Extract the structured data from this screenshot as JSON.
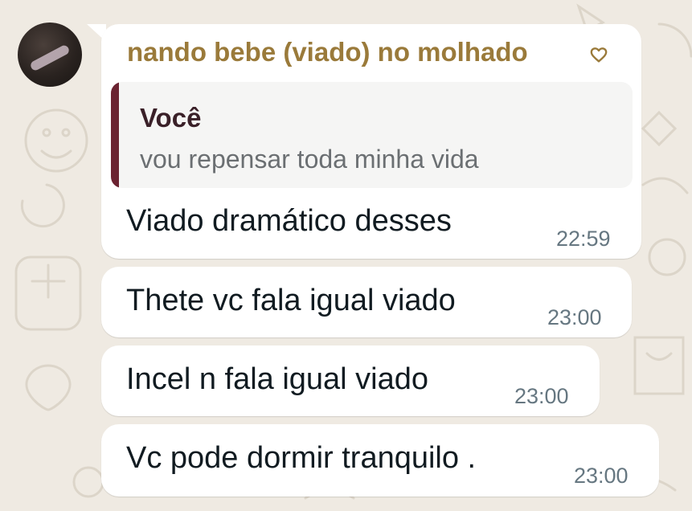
{
  "chat": {
    "sender_name": "nando bebe (viado) no molhado",
    "quote": {
      "author": "Você",
      "text": "vou repensar toda minha vida"
    },
    "messages": [
      {
        "text": "Viado dramático desses",
        "time": "22:59"
      },
      {
        "text": "Thete vc fala igual viado",
        "time": "23:00"
      },
      {
        "text": "Incel n fala igual viado",
        "time": "23:00"
      },
      {
        "text": "Vc pode dormir tranquilo .",
        "time": "23:00"
      }
    ]
  },
  "colors": {
    "background": "#efeae2",
    "bubble": "#ffffff",
    "sender_name": "#9a7a3a",
    "quote_bar": "#6b2331",
    "message_text": "#111b21",
    "timestamp": "#667781"
  },
  "icons": {
    "name_suffix": "heart-outline-icon"
  }
}
